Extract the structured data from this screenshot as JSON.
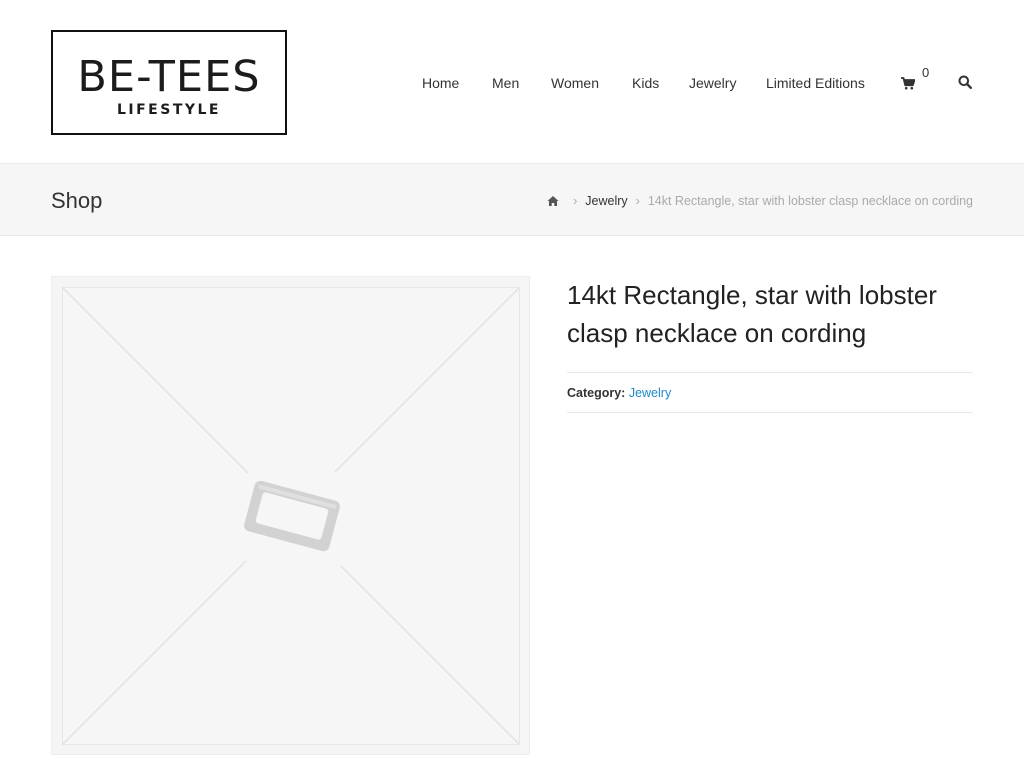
{
  "brand": {
    "name": "BE-TEES",
    "tagline": "LIFESTYLE"
  },
  "nav": {
    "items": [
      {
        "label": "Home"
      },
      {
        "label": "Men"
      },
      {
        "label": "Women"
      },
      {
        "label": "Kids"
      },
      {
        "label": "Jewelry"
      },
      {
        "label": "Limited Editions"
      }
    ],
    "cart_count": "0",
    "cart_icon": "shopping-cart-icon",
    "search_icon": "search-icon"
  },
  "page": {
    "title": "Shop"
  },
  "breadcrumb": {
    "home_icon": "home-icon",
    "items": [
      {
        "label": "Jewelry"
      },
      {
        "label": "14kt Rectangle, star with lobster clasp necklace on cording"
      }
    ]
  },
  "product": {
    "title": "14kt Rectangle, star with lobster clasp necklace on cording",
    "category_label": "Category:",
    "category": "Jewelry",
    "image_icon": "image-placeholder-icon"
  },
  "colors": {
    "accent": "#1e88c7",
    "title_bar": "#f6f6f6",
    "text": "#333333"
  }
}
